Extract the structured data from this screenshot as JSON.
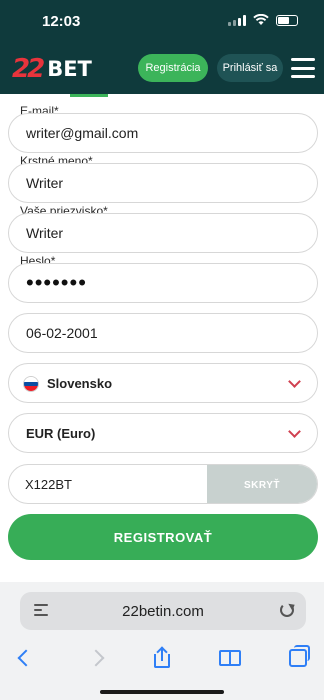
{
  "status_bar": {
    "time": "12:03"
  },
  "header": {
    "logo_number": "22",
    "logo_text": "BET",
    "register_label": "Registrácia",
    "login_label": "Prihlásiť sa"
  },
  "form": {
    "email": {
      "label": "E-mail",
      "required_mark": "*",
      "value": "writer@gmail.com"
    },
    "first_name": {
      "label": "Krstné meno",
      "required_mark": "*",
      "value": "Writer"
    },
    "last_name": {
      "label": "Vaše priezvisko",
      "required_mark": "*",
      "value": "Writer"
    },
    "password": {
      "label": "Heslo",
      "required_mark": "*",
      "masked_value": "•••••••"
    },
    "birth_date": {
      "value": "06-02-2001"
    },
    "country": {
      "value": "Slovensko",
      "flag_colors": [
        "#ffffff",
        "#0b4ea2",
        "#ee1c25"
      ]
    },
    "currency": {
      "value": "EUR (Euro)"
    },
    "promo_code": {
      "value": "X122BT",
      "toggle_label": "SKRYŤ"
    },
    "submit_label": "REGISTROVAŤ"
  },
  "browser": {
    "url": "22betin.com"
  },
  "colors": {
    "header_bg": "#0f3a3c",
    "accent_green": "#37ad57",
    "logo_red": "#e8343c",
    "link_blue": "#2f7ff6"
  }
}
